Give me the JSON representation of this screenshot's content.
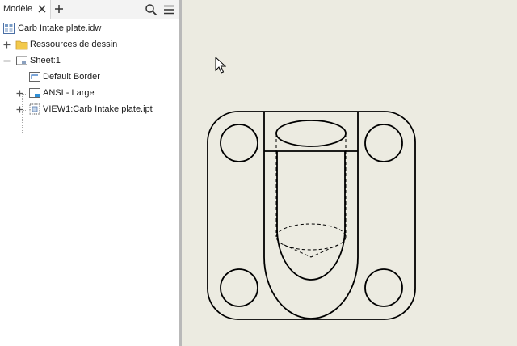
{
  "browser": {
    "tab_label": "Modèle",
    "tree": {
      "root": {
        "label": "Carb Intake plate.idw",
        "icon": "drawing-document-icon"
      },
      "resources": {
        "label": "Ressources de dessin",
        "icon": "folder-icon"
      },
      "sheet": {
        "label": "Sheet:1",
        "icon": "sheet-icon"
      },
      "children": [
        {
          "label": "Default Border",
          "icon": "border-icon"
        },
        {
          "label": "ANSI - Large",
          "icon": "title-block-icon"
        },
        {
          "label": "VIEW1:Carb Intake plate.ipt",
          "icon": "drawing-view-icon"
        }
      ]
    }
  },
  "colors": {
    "canvas_background": "#ecebe1",
    "sketch_lines": "#000000",
    "folder": "#f2c94c"
  }
}
